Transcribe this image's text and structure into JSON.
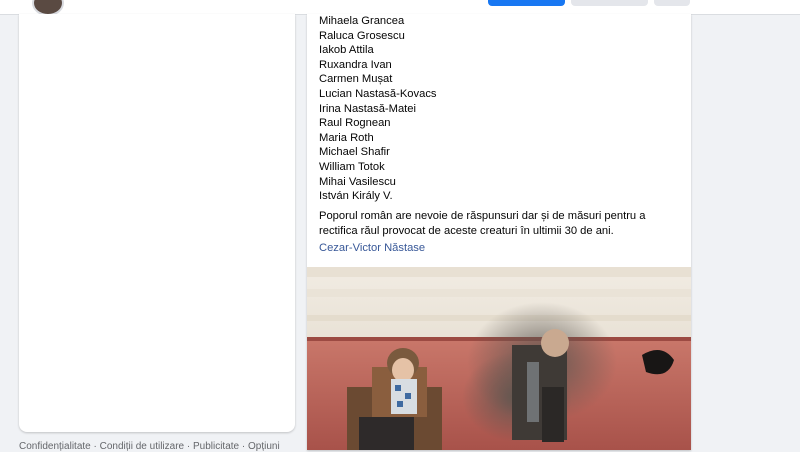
{
  "post": {
    "names": [
      "Mihaela Grancea",
      "Raluca Grosescu",
      "Iakob Attila",
      "Ruxandra Ivan",
      "Carmen Mușat",
      "Lucian Nastasă-Kovacs",
      "Irina Nastasă-Matei",
      "Raul Rognean",
      "Maria Roth",
      "Michael Shafir",
      "William Totok",
      "Mihai Vasilescu",
      "István Király V."
    ],
    "paragraph": "Poporul român are nevoie de răspunsuri dar și de măsuri pentru a rectifica răul provocat de aceste creaturi în ultimii 30 de ani.",
    "author": "Cezar-Victor Năstase"
  },
  "footer": {
    "links": "Confidențialitate · Condiții de utilizare · Publicitate · Opțiuni"
  },
  "colors": {
    "background": "#f0f2f5",
    "primary_button": "#1877f2",
    "link": "#385898"
  }
}
